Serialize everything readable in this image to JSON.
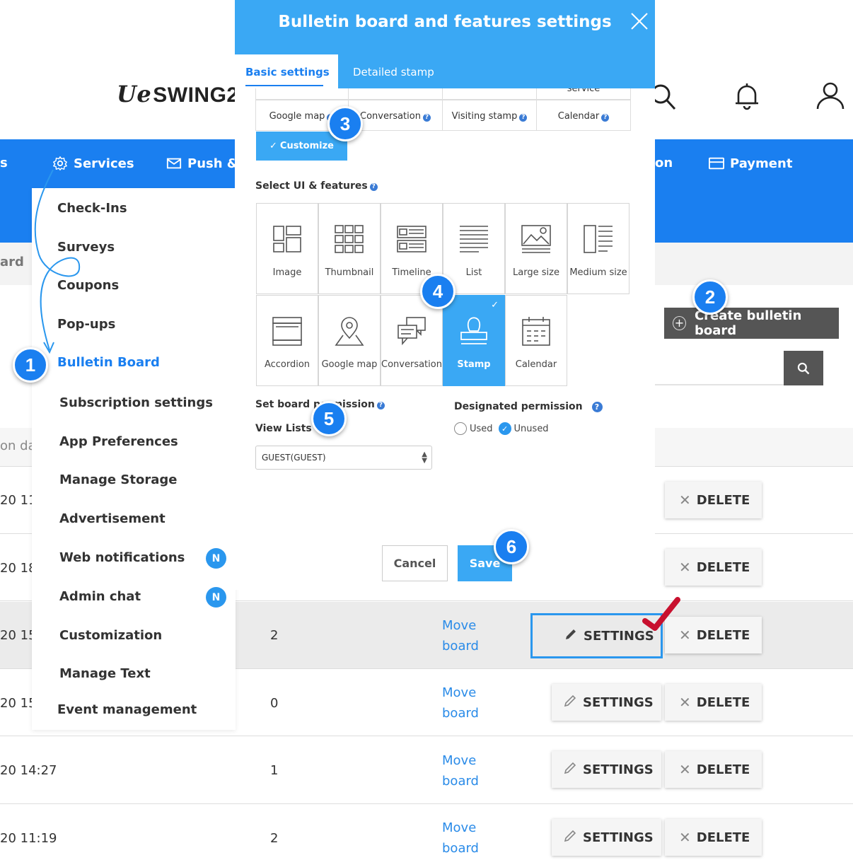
{
  "header": {
    "logo_script": "Ue",
    "logo_text": "SWING2"
  },
  "nav": {
    "services": "Services",
    "push": "Push & N",
    "partial_left": "s",
    "partial_right": "on",
    "payment": "Payment"
  },
  "breadcrumb_partial": "ard",
  "dropdown": {
    "items": [
      "Check-Ins",
      "Surveys",
      "Coupons",
      "Pop-ups",
      "Bulletin Board",
      "Subscription settings",
      "App Preferences",
      "Manage Storage",
      "Advertisement",
      "Web notifications",
      "Admin chat",
      "Customization",
      "Manage Text",
      "Event management"
    ],
    "badge": "N"
  },
  "toolbar": {
    "create_label": "Create bulletin board"
  },
  "table": {
    "date_header_partial": "on da",
    "rows": [
      {
        "date": "20 11",
        "count": "",
        "move": "",
        "settings": "SETTINGS",
        "delete": "DELETE"
      },
      {
        "date": "20 18",
        "count": "",
        "move": "",
        "settings": "SETTINGS",
        "delete": "DELETE"
      },
      {
        "date": "20 15",
        "count": "2",
        "move": "Move board",
        "settings": "SETTINGS",
        "delete": "DELETE"
      },
      {
        "date": "20 15",
        "count": "0",
        "move": "Move board",
        "settings": "SETTINGS",
        "delete": "DELETE"
      },
      {
        "date": "20 14:27",
        "count": "1",
        "move": "Move board",
        "settings": "SETTINGS",
        "delete": "DELETE"
      },
      {
        "date": "20 11:19",
        "count": "2",
        "move": "Move board",
        "settings": "SETTINGS",
        "delete": "DELETE"
      }
    ]
  },
  "modal": {
    "title": "Bulletin board and features settings",
    "tabs": [
      "Basic settings",
      "Detailed stamp"
    ],
    "services_partial": "service",
    "services": [
      "Google map",
      "Conversation",
      "Visiting stamp",
      "Calendar"
    ],
    "customize": "Customize",
    "select_ui_label": "Select UI & features",
    "features": [
      "Image",
      "Thumbnail",
      "Timeline",
      "List",
      "Large size",
      "Medium size",
      "Accordion",
      "Google map",
      "Conversation",
      "Stamp",
      "Calendar"
    ],
    "selected_feature": "Stamp",
    "permission_label": "Set board permission",
    "view_lists_label": "View Lists",
    "view_lists_value": "GUEST(GUEST)",
    "designated_label": "Designated permission",
    "radio_used": "Used",
    "radio_unused": "Unused",
    "radio_selected": "Unused",
    "cancel": "Cancel",
    "save": "Save"
  },
  "steps": [
    "1",
    "2",
    "3",
    "4",
    "5",
    "6"
  ],
  "colors": {
    "nav_blue": "#1a7ff0",
    "modal_blue": "#3aa8f4",
    "step_blue": "#1a7ff0",
    "check_red": "#c8102e"
  }
}
